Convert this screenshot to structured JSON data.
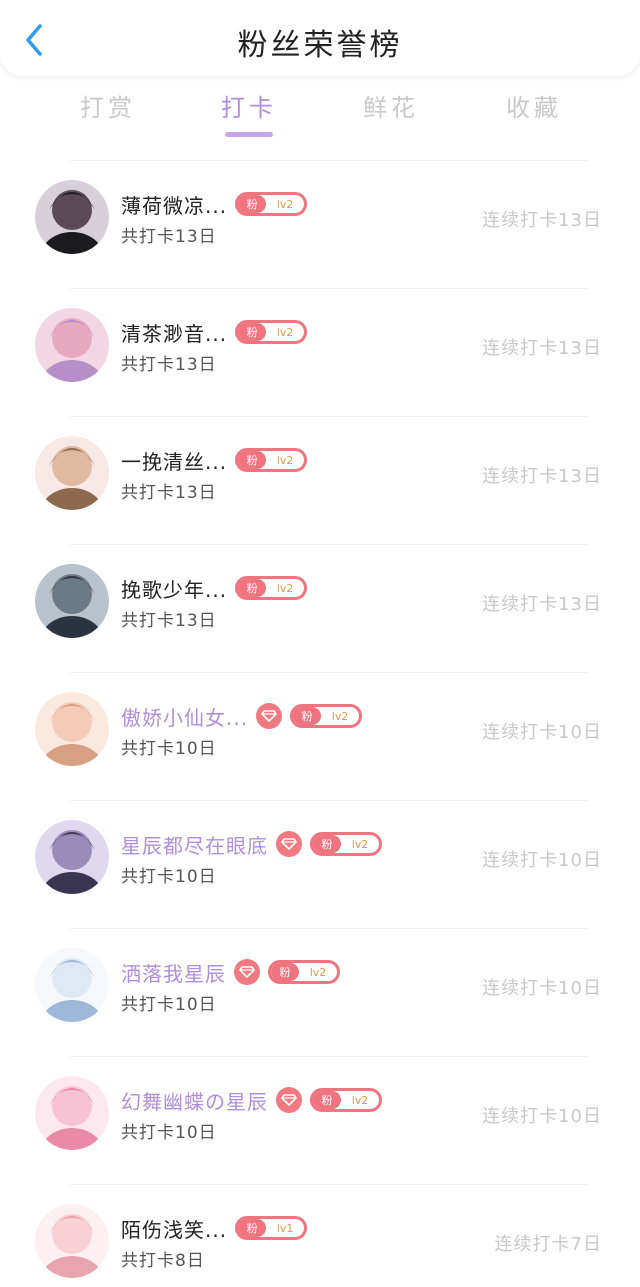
{
  "header": {
    "title": "粉丝荣誉榜"
  },
  "tabs": [
    {
      "label": "打赏",
      "active": false
    },
    {
      "label": "打卡",
      "active": true
    },
    {
      "label": "鲜花",
      "active": false
    },
    {
      "label": "收藏",
      "active": false
    }
  ],
  "colors": {
    "accent": "#b08fd8",
    "badge": "#ef7480",
    "streak_text": "#c8c8c8"
  },
  "rows": [
    {
      "name": "薄荷微凉...",
      "vip": false,
      "badge_text": "粉",
      "level": "lv2",
      "total": "共打卡13日",
      "streak": "连续打卡13日"
    },
    {
      "name": "清茶渺音...",
      "vip": false,
      "badge_text": "粉",
      "level": "lv2",
      "total": "共打卡13日",
      "streak": "连续打卡13日"
    },
    {
      "name": "一挽清丝...",
      "vip": false,
      "badge_text": "粉",
      "level": "lv2",
      "total": "共打卡13日",
      "streak": "连续打卡13日"
    },
    {
      "name": "挽歌少年...",
      "vip": false,
      "badge_text": "粉",
      "level": "lv2",
      "total": "共打卡13日",
      "streak": "连续打卡13日"
    },
    {
      "name": "傲娇小仙女...",
      "vip": true,
      "badge_text": "粉",
      "level": "lv2",
      "total": "共打卡10日",
      "streak": "连续打卡10日"
    },
    {
      "name": "星辰都尽在眼底",
      "vip": true,
      "badge_text": "粉",
      "level": "lv2",
      "total": "共打卡10日",
      "streak": "连续打卡10日"
    },
    {
      "name": "洒落我星辰",
      "vip": true,
      "badge_text": "粉",
      "level": "lv2",
      "total": "共打卡10日",
      "streak": "连续打卡10日"
    },
    {
      "name": "幻舞幽蝶の星辰",
      "vip": true,
      "badge_text": "粉",
      "level": "lv2",
      "total": "共打卡10日",
      "streak": "连续打卡10日"
    },
    {
      "name": "陌伤浅笑...",
      "vip": false,
      "badge_text": "粉",
      "level": "lv1",
      "total": "共打卡8日",
      "streak": "连续打卡7日"
    }
  ]
}
